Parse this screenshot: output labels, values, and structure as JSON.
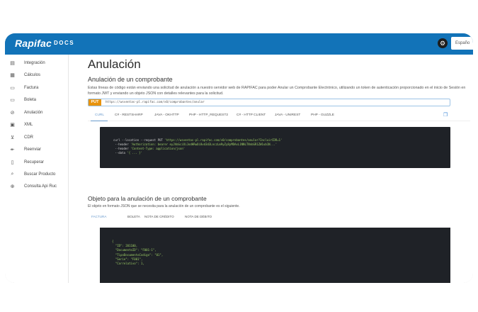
{
  "header": {
    "logo": "Rapifac",
    "logo_suffix": "DOCS",
    "language": "Españo"
  },
  "sidebar": {
    "items": [
      {
        "label": "Integración",
        "icon": "book-icon"
      },
      {
        "label": "Cálculos",
        "icon": "calculator-icon"
      },
      {
        "label": "Factura",
        "icon": "document-icon"
      },
      {
        "label": "Boleta",
        "icon": "receipt-icon"
      },
      {
        "label": "Anulación",
        "icon": "cancel-icon"
      },
      {
        "label": "XML",
        "icon": "code-file-icon"
      },
      {
        "label": "CDR",
        "icon": "download-icon"
      },
      {
        "label": "Reenviar",
        "icon": "resend-icon"
      },
      {
        "label": "Recuperar",
        "icon": "recover-icon"
      },
      {
        "label": "Buscar Producto",
        "icon": "search-product-icon"
      },
      {
        "label": "Consulta Api Ruc",
        "icon": "globe-icon"
      }
    ]
  },
  "main": {
    "title": "Anulación",
    "subtitle": "Anulación de un comprobante",
    "description": "Estas líneas de código están enviando una solicitud de anulación a nuestro servidor web de RAPIFAC para poder Anular un Comprobante Electrónico, utilizando un token de autenticación proporcionado en el inicio de Sesión en formato JWT y enviando un objeto JSON con detalles relevantes para la solicitud.",
    "method": "PUT",
    "endpoint": "https://wsventas-pl.rapifac.com/v0/comprobantes/anular",
    "tabs": [
      "CURL",
      "C# - RESTSHARP",
      "JAVA - OKHTTP",
      "PHP - HTTP_REQUEST2",
      "C# - HTTP CLIENT",
      "JAVA - UNIREST",
      "PHP - GUZZLE"
    ],
    "active_tab": "CURL",
    "code": {
      "l1a": "curl --location --request PUT ",
      "l1b": "'https://wsventas-pl.rapifac.com/v0/comprobantes/anular?IncluirCDR=1'",
      "l2a": "--header ",
      "l2b": "'Authorization: bearer eyJhbGciOiJodHRwOi8vd3d3LnczLm9yZy8yMDAxL1NNLTNnbGR1ZW1ub1N...'",
      "l3a": "--header ",
      "l3b": "'Content-Type: application/json'",
      "l4a": "--data ",
      "l4b": "'{ ... }'"
    },
    "section2_title": "Objeto para la anulación de un comprobante",
    "section2_desc": "El objeto en formato JSON que se necesita para la anulación de un comprobante es el siguiente.",
    "tabs2": [
      "FACTURA",
      "BOLETA",
      "NOTA DE CRÉDITO",
      "NOTA DE DÉBITO"
    ],
    "active_tab2": "FACTURA",
    "json_lines": [
      "{",
      "  \"ID\": 201100,",
      "  \"DocumentoID\": \"F001-1\",",
      "  \"TipoDocumentoCodigo\": \"01\",",
      "  \"Serie\": \"F001\",",
      "  \"Correlativo\": 1,"
    ]
  },
  "colors": {
    "brand": "#1273b8",
    "method_put": "#e8930c",
    "code_bg": "#1f2227",
    "tab_active": "#6a9bcd"
  }
}
